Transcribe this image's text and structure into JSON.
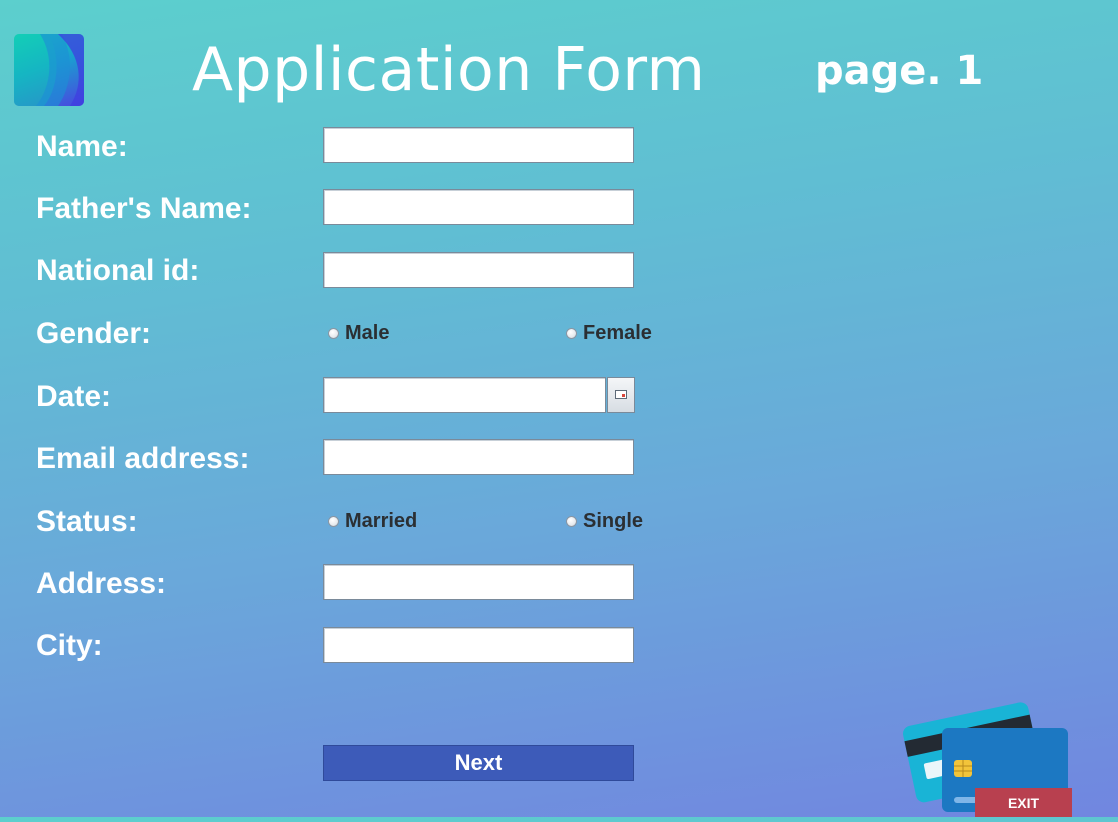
{
  "header": {
    "title": "Application Form",
    "page": "page. 1"
  },
  "form": {
    "name_label": "Name:",
    "fathers_name_label": "Father's Name:",
    "national_id_label": "National id:",
    "gender_label": "Gender:",
    "gender_options": [
      "Male",
      "Female"
    ],
    "date_label": "Date:",
    "email_label": "Email address:",
    "status_label": "Status:",
    "status_options": [
      "Married",
      "Single"
    ],
    "address_label": "Address:",
    "city_label": "City:",
    "values": {
      "name": "",
      "fathers_name": "",
      "national_id": "",
      "date": "",
      "email": "",
      "address": "",
      "city": ""
    }
  },
  "buttons": {
    "next": "Next",
    "exit": "EXIT"
  },
  "icons": {
    "logo": "app-logo",
    "calendar": "calendar-icon",
    "illustration": "credit-cards-illustration"
  },
  "colors": {
    "background_top": "#5ccfcd",
    "background_bottom": "#7186e0",
    "next_button": "#3d5bb9",
    "exit_button": "#b8404f",
    "label_text": "#ffffff",
    "radio_text": "#2b2f33"
  }
}
